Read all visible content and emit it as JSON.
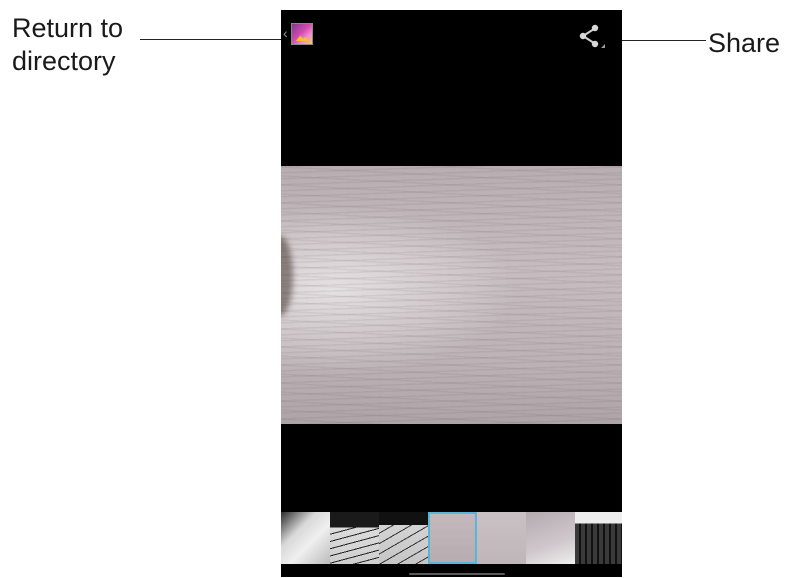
{
  "callouts": {
    "return_label_line1": "Return to",
    "return_label_line2": "directory",
    "share_label": "Share"
  },
  "topbar": {
    "back_glyph": "‹",
    "back_icon": "gallery-app-icon",
    "share_icon": "share-icon"
  },
  "colors": {
    "background": "#000000",
    "selected_thumb_border": "#5ab6d9",
    "callout_text": "#1a1a1a"
  },
  "filmstrip": {
    "thumbnails": [
      {
        "id": 1,
        "selected": false
      },
      {
        "id": 2,
        "selected": false
      },
      {
        "id": 3,
        "selected": false
      },
      {
        "id": 4,
        "selected": true
      },
      {
        "id": 5,
        "selected": false
      },
      {
        "id": 6,
        "selected": false
      },
      {
        "id": 7,
        "selected": false
      }
    ]
  }
}
